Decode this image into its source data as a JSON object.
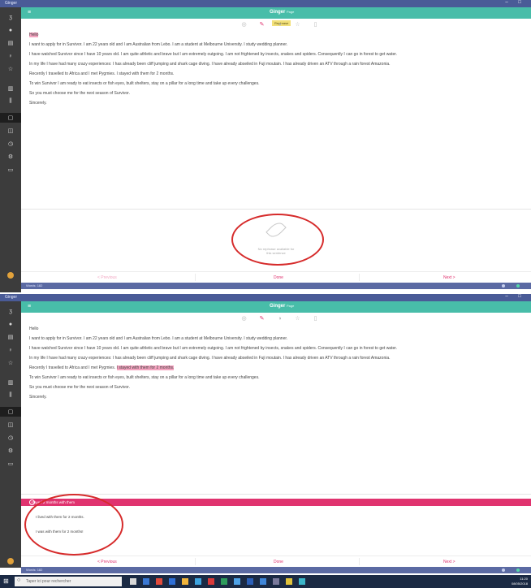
{
  "window": {
    "title": "Ginger",
    "minimize": "–",
    "maximize": "□"
  },
  "app": {
    "logo_text": "Ginger",
    "logo_sub": "Page"
  },
  "toolbar": {
    "tooltip": "Rephrase"
  },
  "document": {
    "paragraphs": [
      "Hello",
      "I want to apply for in Survivor. I am 22 years old and I am Australian from Lebo. I am a student at Melbourne University. I study wedding planner.",
      "I have watched Survivor since I have 10 years old. I am quite athletic and brave but I am extremely outgoing. I am not frightened by insects, snakes and spiders. Consequently I can go in forest to get water.",
      "In my life I have had many crazy experiences: I has already been cliff jumping and shark cage diving. I have already abseiled in Fuji moutain. I has already driven an ATV through a rain forest Amazonia.",
      "Recently I travelled to Africa and I met Pygmies. I stayed with them for 2 months.",
      "To win Survivor I am ready to eat insects or fish eyes, built shelters, stay on a pillar for a long time and take up every challenges.",
      "So you must choose me for the next season of Survivor.",
      "Sincerely."
    ],
    "p5_prefix": "Recently I travelled to Africa and I met Pygmies. ",
    "p5_highlight": "I stayed with them for 2 months."
  },
  "rephrase_panel": {
    "empty_message_line1": "No rephrase available for",
    "empty_message_line2": "this sentence",
    "suggestions": [
      "I stayed 2 months with them",
      "I lived with them for 2 months.",
      "I was with them for 2 months!"
    ]
  },
  "navigation": {
    "previous": "< Previous",
    "done": "Done",
    "next": "Next >"
  },
  "statusbar": {
    "word_count": "Words: 182"
  },
  "taskbar": {
    "search_placeholder": "Taper ici pour rechercher",
    "time": "11:20",
    "date": "08/05/2018"
  },
  "colors": {
    "accent_teal": "#48bda9",
    "accent_pink": "#e0336f",
    "annotation_red": "#d62b2b",
    "highlight_pink": "#f4a3bf"
  }
}
